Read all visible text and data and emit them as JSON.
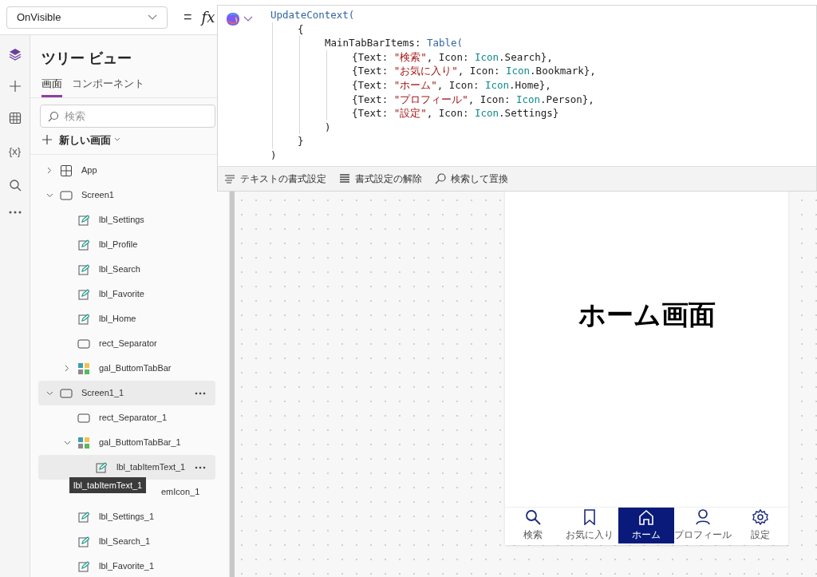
{
  "property_dropdown": {
    "value": "OnVisible"
  },
  "formula_bar": {
    "equals": "=",
    "fx": "fx"
  },
  "rail": [
    {
      "kind": "layers",
      "selected": true
    },
    {
      "kind": "plus",
      "selected": false
    },
    {
      "kind": "table",
      "selected": false
    },
    {
      "kind": "variables",
      "label": "{x}",
      "selected": false
    },
    {
      "kind": "search",
      "selected": false
    },
    {
      "kind": "more",
      "selected": false
    }
  ],
  "tree_view": {
    "title": "ツリー ビュー",
    "tabs": [
      {
        "label": "画面",
        "selected": true
      },
      {
        "label": "コンポーネント",
        "selected": false
      }
    ],
    "search": {
      "placeholder": "検索"
    },
    "new_screen": "新しい画面",
    "items": [
      {
        "label": "App",
        "kind": "app",
        "expanded": false,
        "highlighted": false
      },
      {
        "label": "Screen1",
        "kind": "screen",
        "expanded": true,
        "highlighted": false,
        "children": [
          {
            "label": "lbl_Settings",
            "kind": "label",
            "highlighted": false
          },
          {
            "label": "lbl_Profile",
            "kind": "label",
            "highlighted": false
          },
          {
            "label": "lbl_Search",
            "kind": "label",
            "highlighted": false
          },
          {
            "label": "lbl_Favorite",
            "kind": "label",
            "highlighted": false
          },
          {
            "label": "lbl_Home",
            "kind": "label",
            "highlighted": false
          },
          {
            "label": "rect_Separator",
            "kind": "rect",
            "highlighted": false
          },
          {
            "label": "gal_ButtomTabBar",
            "kind": "gallery",
            "expanded": false,
            "highlighted": false
          }
        ]
      },
      {
        "label": "Screen1_1",
        "kind": "screen",
        "expanded": true,
        "highlighted": true,
        "children": [
          {
            "label": "rect_Separator_1",
            "kind": "rect",
            "highlighted": false
          },
          {
            "label": "gal_ButtomTabBar_1",
            "kind": "gallery",
            "expanded": true,
            "highlighted": false,
            "children": [
              {
                "label": "lbl_tabItemText_1",
                "kind": "label",
                "highlighted": true
              },
              {
                "label": "emIcon_1",
                "kind": "covered",
                "highlighted": false
              }
            ]
          },
          {
            "label": "lbl_Settings_1",
            "kind": "label",
            "highlighted": false
          },
          {
            "label": "lbl_Search_1",
            "kind": "label",
            "highlighted": false
          },
          {
            "label": "lbl_Favorite_1",
            "kind": "label",
            "highlighted": false
          }
        ]
      }
    ],
    "tooltip": "lbl_tabItemText_1"
  },
  "code": [
    {
      "tokens": [
        {
          "kind": "fn",
          "text": "UpdateContext("
        }
      ],
      "children": [
        {
          "tokens": [
            {
              "kind": "plain",
              "text": "{"
            }
          ],
          "children": [
            {
              "tokens": [
                {
                  "kind": "plain",
                  "text": "MainTabBarItems: "
                },
                {
                  "kind": "fn",
                  "text": "Table("
                }
              ],
              "children": [
                {
                  "tokens": [
                    {
                      "kind": "plain",
                      "text": "{Text: "
                    },
                    {
                      "kind": "str",
                      "text": "\"検索\""
                    },
                    {
                      "kind": "plain",
                      "text": ", Icon: "
                    },
                    {
                      "kind": "enum",
                      "text": "Icon"
                    },
                    {
                      "kind": "plain",
                      "text": ".Search},"
                    }
                  ]
                },
                {
                  "tokens": [
                    {
                      "kind": "plain",
                      "text": "{Text: "
                    },
                    {
                      "kind": "str",
                      "text": "\"お気に入り\""
                    },
                    {
                      "kind": "plain",
                      "text": ", Icon: "
                    },
                    {
                      "kind": "enum",
                      "text": "Icon"
                    },
                    {
                      "kind": "plain",
                      "text": ".Bookmark},"
                    }
                  ]
                },
                {
                  "tokens": [
                    {
                      "kind": "plain",
                      "text": "{Text: "
                    },
                    {
                      "kind": "str",
                      "text": "\"ホーム\""
                    },
                    {
                      "kind": "plain",
                      "text": ", Icon: "
                    },
                    {
                      "kind": "enum",
                      "text": "Icon"
                    },
                    {
                      "kind": "plain",
                      "text": ".Home},"
                    }
                  ]
                },
                {
                  "tokens": [
                    {
                      "kind": "plain",
                      "text": "{Text: "
                    },
                    {
                      "kind": "str",
                      "text": "\"プロフィール\""
                    },
                    {
                      "kind": "plain",
                      "text": ", Icon: "
                    },
                    {
                      "kind": "enum",
                      "text": "Icon"
                    },
                    {
                      "kind": "plain",
                      "text": ".Person},"
                    }
                  ]
                },
                {
                  "tokens": [
                    {
                      "kind": "plain",
                      "text": "{Text: "
                    },
                    {
                      "kind": "str",
                      "text": "\"設定\""
                    },
                    {
                      "kind": "plain",
                      "text": ", Icon: "
                    },
                    {
                      "kind": "enum",
                      "text": "Icon"
                    },
                    {
                      "kind": "plain",
                      "text": ".Settings}"
                    }
                  ]
                }
              ]
            },
            {
              "tokens": [
                {
                  "kind": "plain",
                  "text": ")"
                }
              ]
            }
          ]
        },
        {
          "tokens": [
            {
              "kind": "plain",
              "text": "}"
            }
          ]
        }
      ]
    },
    {
      "tokens": [
        {
          "kind": "plain",
          "text": ")"
        }
      ]
    }
  ],
  "code_toolbar": [
    {
      "kind": "format",
      "label": "テキストの書式設定"
    },
    {
      "kind": "unformat",
      "label": "書式設定の解除"
    },
    {
      "kind": "find",
      "label": "検索して置換"
    }
  ],
  "screen_preview": {
    "heading": "ホーム画面",
    "tabs": [
      {
        "label": "検索",
        "kind": "search",
        "selected": false
      },
      {
        "label": "お気に入り",
        "kind": "bookmark",
        "selected": false
      },
      {
        "label": "ホーム",
        "kind": "home",
        "selected": true
      },
      {
        "label": "プロフィール",
        "kind": "person",
        "selected": false
      },
      {
        "label": "設定",
        "kind": "settings",
        "selected": false
      }
    ]
  }
}
